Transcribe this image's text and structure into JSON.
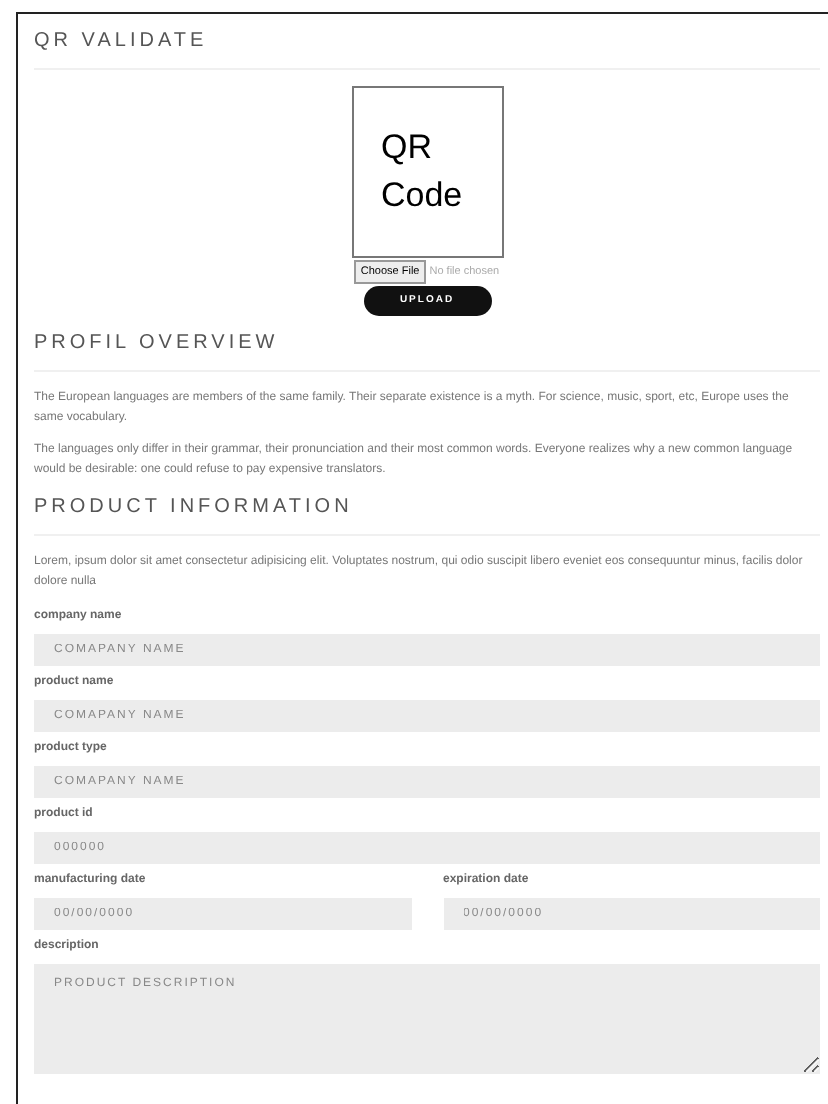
{
  "qr_section": {
    "title": "QR VALIDATE",
    "qr_image_text": "QR Code",
    "file_button": "Choose File",
    "file_status": "No file chosen",
    "upload_button": "UPLOAD"
  },
  "profile_section": {
    "title": "PROFIL OVERVIEW",
    "paragraphs": [
      "The European languages are members of the same family. Their separate existence is a myth. For science, music, sport, etc, Europe uses the same vocabulary.",
      "The languages only differ in their grammar, their pronunciation and their most common words. Everyone realizes why a new common language would be desirable: one could refuse to pay expensive translators."
    ]
  },
  "product_section": {
    "title": "PRODUCT INFORMATION",
    "intro": "Lorem, ipsum dolor sit amet consectetur adipisicing elit. Voluptates nostrum, qui odio suscipit libero eveniet eos consequuntur minus, facilis dolor dolore nulla",
    "rows": [
      {
        "fields": [
          {
            "label": "company name",
            "placeholder": "COMAPANY NAME",
            "kind": "input"
          }
        ]
      },
      {
        "fields": [
          {
            "label": "product name",
            "placeholder": "COMAPANY NAME",
            "kind": "input"
          }
        ]
      },
      {
        "fields": [
          {
            "label": "product type",
            "placeholder": "COMAPANY NAME",
            "kind": "input"
          }
        ]
      },
      {
        "fields": [
          {
            "label": "product id",
            "placeholder": "000000",
            "kind": "input"
          }
        ]
      },
      {
        "fields": [
          {
            "label": "manufacturing date",
            "placeholder": "00/00/0000",
            "kind": "input"
          },
          {
            "label": "expiration date",
            "placeholder": "00/00/0000",
            "kind": "input"
          }
        ]
      },
      {
        "fields": [
          {
            "label": "description",
            "placeholder": "PRODUCT DESCRIPTION",
            "kind": "textarea"
          }
        ]
      }
    ]
  }
}
